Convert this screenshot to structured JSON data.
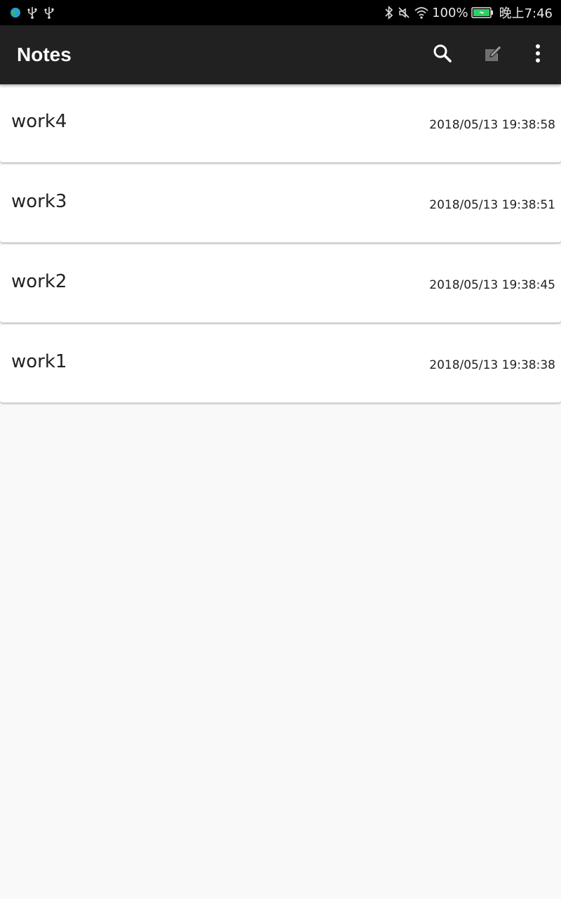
{
  "status_bar": {
    "battery_percent": "100%",
    "time": "晚上7:46",
    "left_icons": [
      "app-globe-icon",
      "usb-icon",
      "usb-icon"
    ],
    "right_icons": [
      "bluetooth-icon",
      "mute-icon",
      "wifi-icon",
      "battery-charging-icon"
    ],
    "battery_color": "#2bd062"
  },
  "app_bar": {
    "title": "Notes",
    "actions": [
      "search-icon",
      "compose-icon",
      "more-vert-icon"
    ],
    "background": "#212121"
  },
  "notes": [
    {
      "title": "work4",
      "timestamp": "2018/05/13 19:38:58"
    },
    {
      "title": "work3",
      "timestamp": "2018/05/13 19:38:51"
    },
    {
      "title": "work2",
      "timestamp": "2018/05/13 19:38:45"
    },
    {
      "title": "work1",
      "timestamp": "2018/05/13 19:38:38"
    }
  ]
}
